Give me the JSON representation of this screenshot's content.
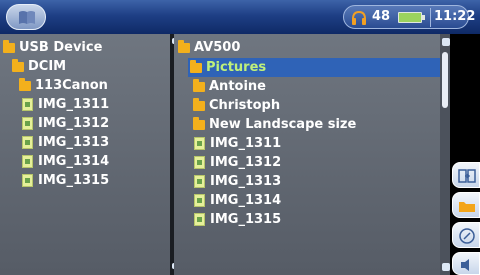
{
  "status": {
    "volume": "48",
    "time": "11:22"
  },
  "left_pane": {
    "items": [
      {
        "label": "USB Device",
        "type": "folder",
        "indent": 0
      },
      {
        "label": "DCIM",
        "type": "folder",
        "indent": 1
      },
      {
        "label": "113Canon",
        "type": "folder",
        "indent": 2
      },
      {
        "label": "IMG_1311",
        "type": "image",
        "indent": 3
      },
      {
        "label": "IMG_1312",
        "type": "image",
        "indent": 3
      },
      {
        "label": "IMG_1313",
        "type": "image",
        "indent": 3
      },
      {
        "label": "IMG_1314",
        "type": "image",
        "indent": 3
      },
      {
        "label": "IMG_1315",
        "type": "image",
        "indent": 3
      }
    ]
  },
  "right_pane": {
    "items": [
      {
        "label": "AV500",
        "type": "folder",
        "indent": 0
      },
      {
        "label": "Pictures",
        "type": "folder",
        "indent": 1,
        "selected": true
      },
      {
        "label": "Antoine",
        "type": "folder",
        "indent": 1
      },
      {
        "label": "Christoph",
        "type": "folder",
        "indent": 1
      },
      {
        "label": "New Landscape size",
        "type": "folder",
        "indent": 1
      },
      {
        "label": "IMG_1311",
        "type": "image",
        "indent": 1
      },
      {
        "label": "IMG_1312",
        "type": "image",
        "indent": 1
      },
      {
        "label": "IMG_1313",
        "type": "image",
        "indent": 1
      },
      {
        "label": "IMG_1314",
        "type": "image",
        "indent": 1
      },
      {
        "label": "IMG_1315",
        "type": "image",
        "indent": 1
      }
    ]
  },
  "actions": [
    {
      "icon": "copy-icon"
    },
    {
      "icon": "folder-icon"
    },
    {
      "icon": "rename-icon"
    },
    {
      "icon": "audio-icon"
    }
  ],
  "colors": {
    "selection": "#2f63b7",
    "folder": "#f3b01c",
    "topbar": "#1e3f85"
  }
}
